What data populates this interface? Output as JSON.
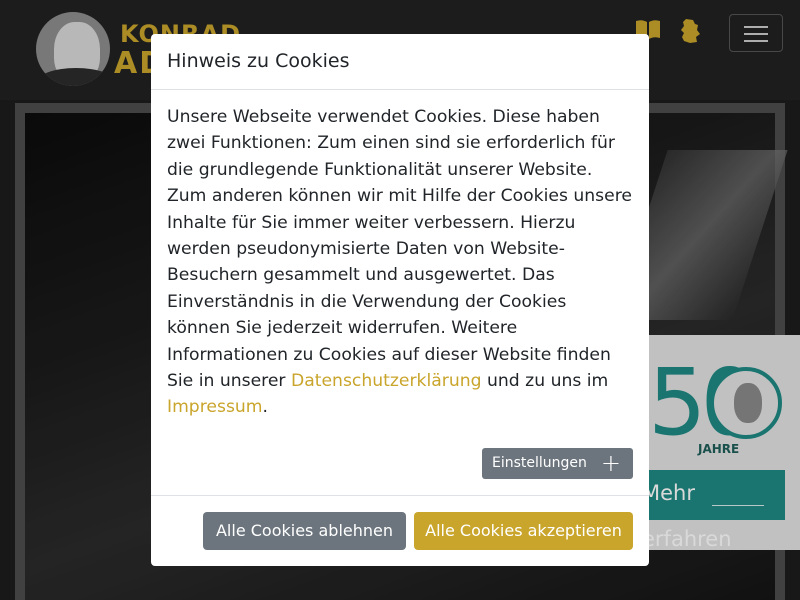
{
  "header": {
    "logo_line1": "KONRAD",
    "logo_line2": "ADENAUER",
    "icons": [
      "book-icon",
      "map-germany-icon",
      "hamburger-menu-icon"
    ],
    "accent_color": "#c9a52c"
  },
  "promo": {
    "number": "50",
    "jahre": "JAHRE",
    "cta_label": "Mehr erfahren",
    "color": "#1f8a84"
  },
  "cookie_modal": {
    "title": "Hinweis zu Cookies",
    "body_text": "Unsere Webseite verwendet Cookies. Diese haben zwei Funktionen: Zum einen sind sie erforderlich für die grundlegende Funktionalität unserer Website. Zum anderen können wir mit Hilfe der Cookies unsere Inhalte für Sie immer weiter verbessern. Hierzu werden pseudonymisierte Daten von Website-Besuchern gesammelt und ausgewertet. Das Einverständnis in die Verwendung der Cookies können Sie jederzeit widerrufen. Weitere Informationen zu Cookies auf dieser Website finden Sie in unserer ",
    "privacy_link": "Datenschutzerklärung",
    "middle_text": " und zu uns im ",
    "imprint_link": "Impressum",
    "end_text": ".",
    "settings_label": "Einstellungen",
    "settings_icon": "+",
    "reject_label": "Alle Cookies ablehnen",
    "accept_label": "Alle Cookies akzeptieren",
    "accept_color": "#c9a52c",
    "reject_color": "#6c757d"
  }
}
